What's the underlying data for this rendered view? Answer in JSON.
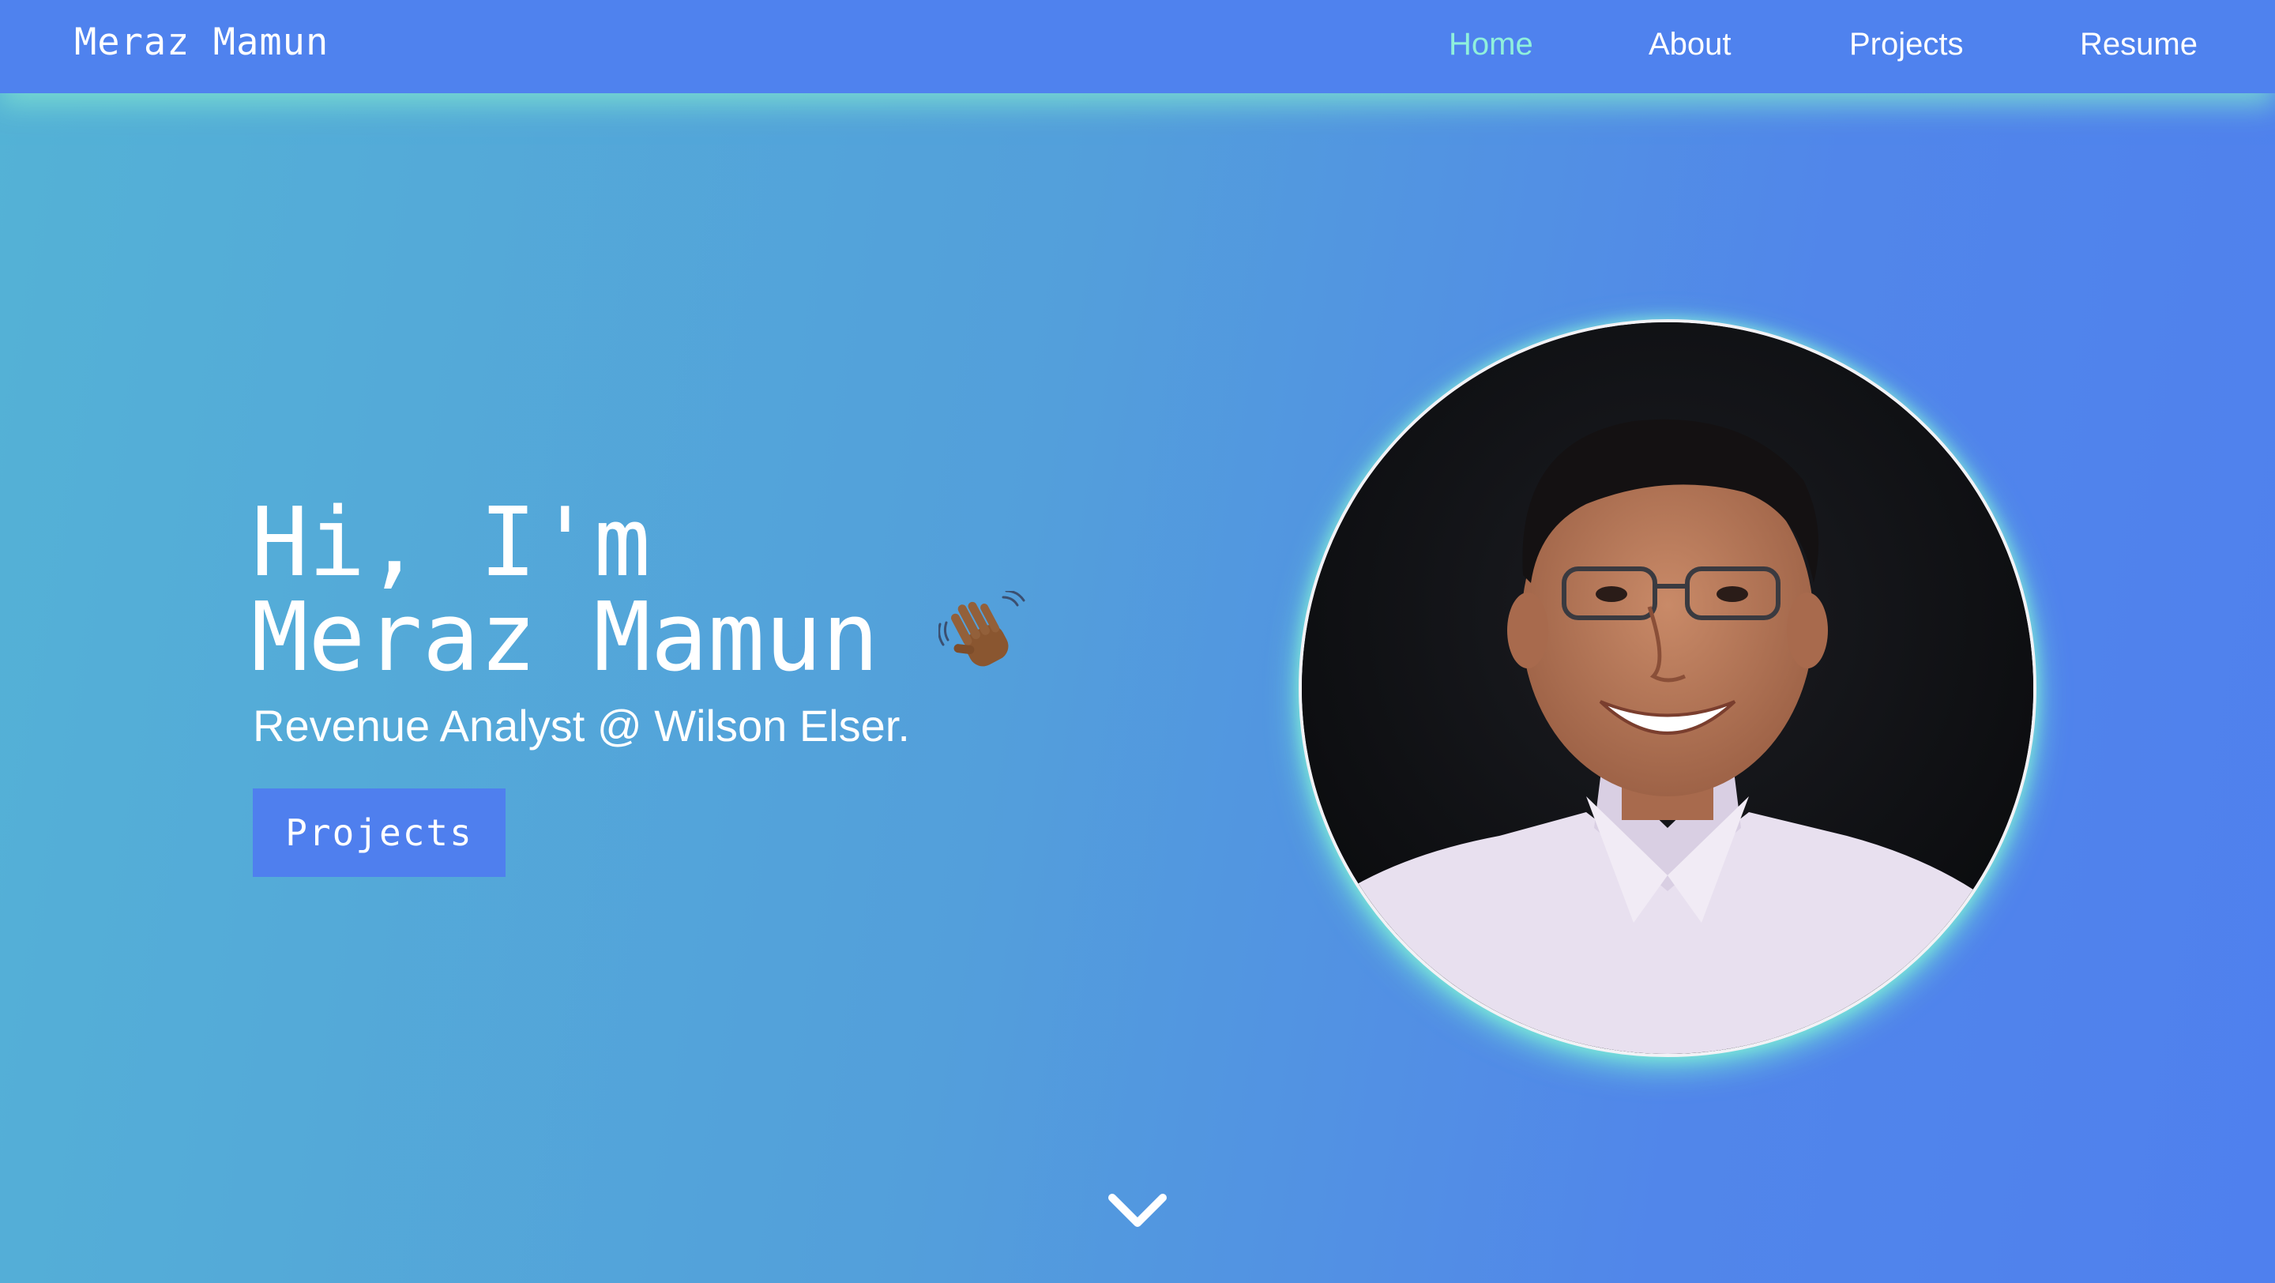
{
  "navbar": {
    "brand": "Meraz Mamun",
    "links": [
      {
        "label": "Home",
        "active": true
      },
      {
        "label": "About",
        "active": false
      },
      {
        "label": "Projects",
        "active": false
      },
      {
        "label": "Resume",
        "active": false
      }
    ]
  },
  "hero": {
    "greeting": "Hi, I'm",
    "name": "Meraz Mamun",
    "tagline": "Revenue Analyst @ Wilson Elser.",
    "button_label": "Projects",
    "wave_icon": "waving-hand-icon",
    "scroll_icon": "chevron-down-icon"
  },
  "colors": {
    "navbar": "#4f82ee",
    "active_link": "#8ff0dc",
    "button": "#4f7fee",
    "gradient_start": "#54b2d6",
    "gradient_end": "#4f80ee",
    "glow": "#7ce0d0"
  }
}
